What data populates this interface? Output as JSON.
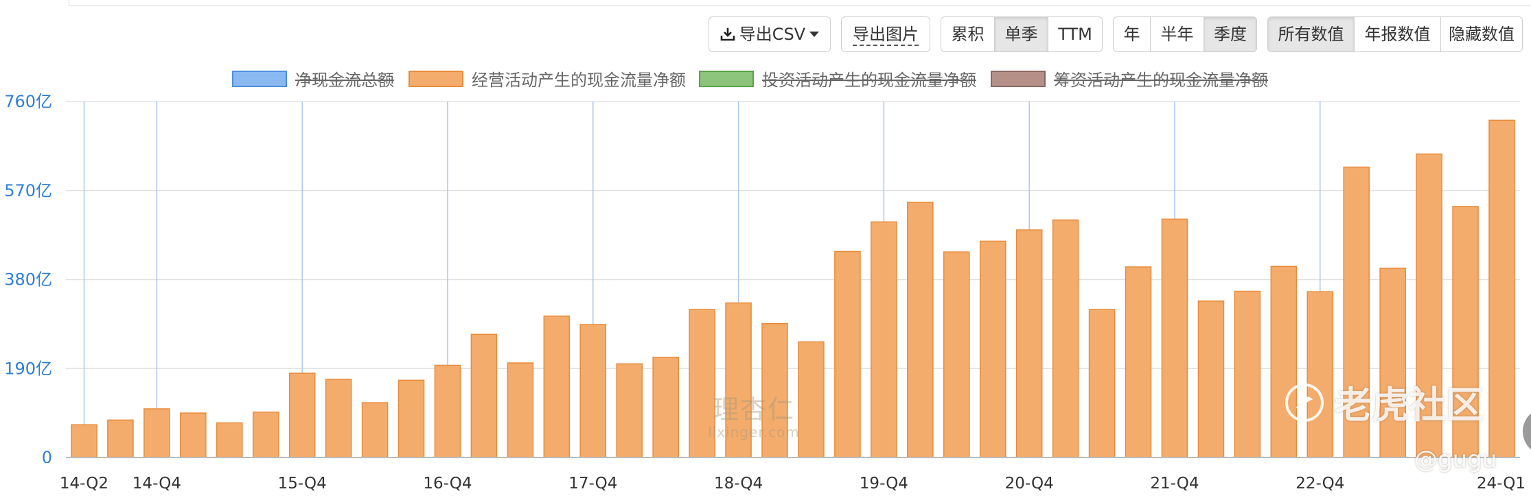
{
  "toolbar": {
    "export_csv": "导出CSV",
    "export_image": "导出图片",
    "mode_group": [
      {
        "label": "累积",
        "active": false
      },
      {
        "label": "单季",
        "active": true
      },
      {
        "label": "TTM",
        "active": false
      }
    ],
    "period_group": [
      {
        "label": "年",
        "active": false
      },
      {
        "label": "半年",
        "active": false
      },
      {
        "label": "季度",
        "active": true
      }
    ],
    "values_group": [
      {
        "label": "所有数值",
        "active": true
      },
      {
        "label": "年报数值",
        "active": false
      },
      {
        "label": "隐藏数值",
        "active": false
      }
    ]
  },
  "legend": [
    {
      "label": "净现金流总额",
      "color": "#8ab8f0",
      "border": "#4c8fe0",
      "enabled": false
    },
    {
      "label": "经营活动产生的现金流量净额",
      "color": "#f3ac6c",
      "border": "#e88c3c",
      "enabled": true
    },
    {
      "label": "投资活动产生的现金流量净额",
      "color": "#8cc47c",
      "border": "#5aa24a",
      "enabled": false
    },
    {
      "label": "筹资活动产生的现金流量净额",
      "color": "#b49088",
      "border": "#8a6860",
      "enabled": false
    }
  ],
  "watermarks": {
    "lixinger_cn": "理杏仁",
    "lixinger_en": "lixinger.com",
    "tiger": "老虎社区",
    "user": "@gugu"
  },
  "chart_data": {
    "type": "bar",
    "series_name": "经营活动产生的现金流量净额",
    "unit": "亿",
    "categories": [
      "14-Q2",
      "14-Q3",
      "14-Q4",
      "15-Q1",
      "15-Q2",
      "15-Q3",
      "15-Q4",
      "16-Q1",
      "16-Q2",
      "16-Q3",
      "16-Q4",
      "17-Q1",
      "17-Q2",
      "17-Q3",
      "17-Q4",
      "18-Q1",
      "18-Q2",
      "18-Q3",
      "18-Q4",
      "19-Q1",
      "19-Q2",
      "19-Q3",
      "19-Q4",
      "20-Q1",
      "20-Q2",
      "20-Q3",
      "20-Q4",
      "21-Q1",
      "21-Q2",
      "21-Q3",
      "21-Q4",
      "22-Q1",
      "22-Q2",
      "22-Q3",
      "22-Q4",
      "23-Q1",
      "23-Q2",
      "23-Q3",
      "23-Q4",
      "24-Q1"
    ],
    "values": [
      70,
      80,
      104,
      95,
      74,
      97,
      180,
      167,
      117,
      165,
      197,
      263,
      202,
      302,
      284,
      200,
      214,
      316,
      330,
      286,
      247,
      440,
      503,
      545,
      439,
      462,
      486,
      507,
      316,
      407,
      509,
      334,
      355,
      408,
      354,
      620,
      404,
      648,
      536,
      720
    ],
    "ylim": [
      0,
      760
    ],
    "yticks": [
      0,
      190,
      380,
      570,
      760
    ],
    "ytick_labels": [
      "0",
      "190亿",
      "380亿",
      "570亿",
      "760亿"
    ],
    "xtick_labels": [
      "14-Q2",
      "14-Q4",
      "15-Q4",
      "16-Q4",
      "17-Q4",
      "18-Q4",
      "19-Q4",
      "20-Q4",
      "21-Q4",
      "22-Q4",
      "24-Q1"
    ],
    "xtick_indices": [
      0,
      2,
      6,
      10,
      14,
      18,
      22,
      26,
      30,
      34,
      39
    ],
    "vertical_grid_indices": [
      0,
      2,
      6,
      10,
      14,
      18,
      22,
      26,
      30,
      34
    ],
    "bar_color": "#f3ac6c",
    "bar_border": "#e88c3c",
    "axis_label_color": "#2f7fd6",
    "grid": true
  }
}
